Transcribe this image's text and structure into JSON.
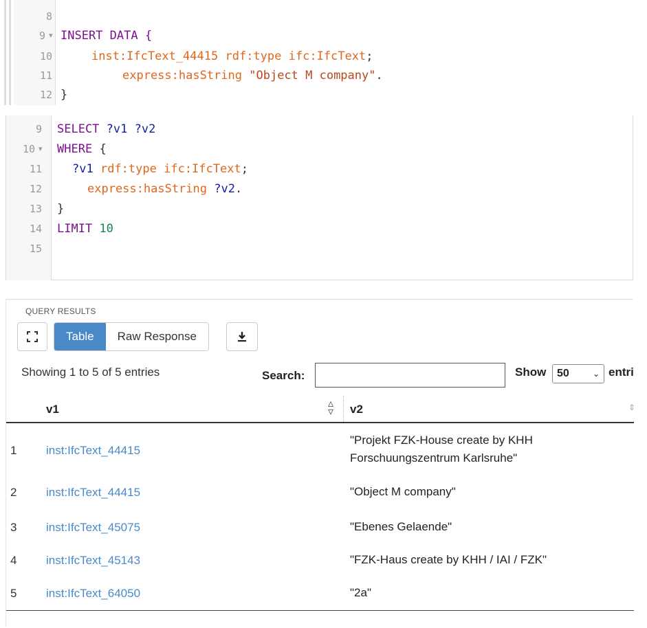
{
  "editor1": {
    "lines": [
      {
        "num": "8",
        "text": ""
      },
      {
        "num": "9",
        "text": "INSERT DATA {"
      },
      {
        "num": "10",
        "subject": "inst:IfcText_44415",
        "predicate": "rdf:type",
        "object": "ifc:IfcText",
        "end": ";"
      },
      {
        "num": "11",
        "predicate": "express:hasString",
        "literal": "\"Object M company\"",
        "end": "."
      },
      {
        "num": "12",
        "text": "}"
      }
    ]
  },
  "editor2": {
    "lines": [
      {
        "num": "9",
        "kw": "SELECT",
        "vars": "?v1 ?v2"
      },
      {
        "num": "10",
        "kw": "WHERE",
        "brace": "{"
      },
      {
        "num": "11",
        "subject": "?v1",
        "predicate": "rdf:type",
        "object": "ifc:IfcText",
        "end": ";"
      },
      {
        "num": "12",
        "predicate": "express:hasString",
        "object": "?v2",
        "end": "."
      },
      {
        "num": "13",
        "text": "}"
      },
      {
        "num": "14",
        "kw": "LIMIT",
        "value": "10"
      },
      {
        "num": "15",
        "text": ""
      }
    ]
  },
  "results": {
    "title": "QUERY RESULTS",
    "tabs": {
      "table": "Table",
      "raw": "Raw Response"
    },
    "info": "Showing 1 to 5 of 5 entries",
    "search_label": "Search:",
    "search_value": "",
    "show_label": "Show",
    "show_value": "50",
    "entries_label": "entries",
    "columns": [
      "v1",
      "v2"
    ],
    "rows": [
      {
        "idx": "1",
        "v1": "inst:IfcText_44415",
        "v2_line1": "\"Projekt FZK-House create by KHH",
        "v2_line2": "Forschuungszentrum Karlsruhe\""
      },
      {
        "idx": "2",
        "v1": "inst:IfcText_44415",
        "v2_line1": "\"Object M company\""
      },
      {
        "idx": "3",
        "v1": "inst:IfcText_45075",
        "v2_line1": "\"Ebenes Gelaende\""
      },
      {
        "idx": "4",
        "v1": "inst:IfcText_45143",
        "v2_line1": "\"FZK-Haus create by KHH / IAI / FZK\""
      },
      {
        "idx": "5",
        "v1": "inst:IfcText_64050",
        "v2_line1": "\"2a\""
      }
    ]
  },
  "icons": {
    "fullscreen": "fullscreen-icon",
    "download": "download-icon",
    "fold": "fold-arrow-icon",
    "sort": "sort-icon"
  }
}
